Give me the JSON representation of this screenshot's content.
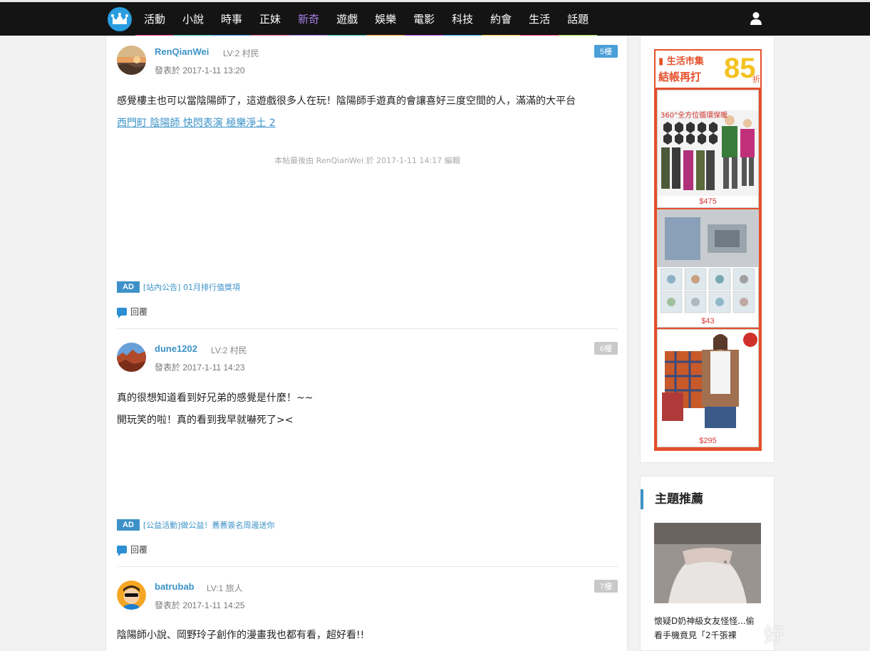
{
  "nav": {
    "items": [
      {
        "label": "活動",
        "color": "#e83e8c"
      },
      {
        "label": "小說",
        "color": "#2ab7a9"
      },
      {
        "label": "時事",
        "color": "#3b8ed9"
      },
      {
        "label": "正妹",
        "color": "#e85d9a"
      },
      {
        "label": "新奇",
        "color": "#a77ee8"
      },
      {
        "label": "遊戲",
        "color": "#2ab7a9"
      },
      {
        "label": "娛樂",
        "color": "#f0a030"
      },
      {
        "label": "電影",
        "color": "#b04ad8"
      },
      {
        "label": "科技",
        "color": "#22a3d8"
      },
      {
        "label": "約會",
        "color": "#f0c040"
      },
      {
        "label": "生活",
        "color": "#e83e6c"
      },
      {
        "label": "話題",
        "color": "#9bd84a"
      }
    ],
    "active_index": 4
  },
  "posts": [
    {
      "username": "RenQianWei",
      "level": "LV:2 村民",
      "date": "發表於 2017-1-11 13:20",
      "floor": "5樓",
      "lines": [
        "感覺樓主也可以當陰陽師了，這遊戲很多人在玩！陰陽師手遊真的會讓喜好三度空間的人，滿滿的大平台"
      ],
      "link": "西門町 陰陽師 快閃表演 極樂淨土 2",
      "edited": "本帖最後由 RenQianWei 於 2017-1-11 14:17 編輯",
      "ad_badge": "AD",
      "ad_text": "[站內公告] 01月排行值獎項",
      "reply": "回覆"
    },
    {
      "username": "dune1202",
      "level": "LV:2 村民",
      "date": "發表於 2017-1-11 14:23",
      "floor": "6樓",
      "lines": [
        "真的很想知道看到好兄弟的感覺是什麼！~~",
        "開玩笑的啦！真的看到我早就嚇死了><"
      ],
      "ad_badge": "AD",
      "ad_text": "[公益活動]做公益！蕎蕎簽名周邊送你",
      "reply": "回覆"
    },
    {
      "username": "batrubab",
      "level": "LV:1 旅人",
      "date": "發表於 2017-1-11 14:25",
      "floor": "7樓",
      "lines": [
        "陰陽師小說、岡野玲子創作的漫畫我也都有看，超好看!!"
      ]
    }
  ],
  "sidebar": {
    "ad": {
      "brand": "生活市集",
      "headline": "結帳再打",
      "discount": "85",
      "discount_suffix": "折",
      "product1_caption": "360°全方位循環保暖",
      "prices": [
        "$475",
        "$43",
        "$295"
      ]
    },
    "recommend": {
      "title": "主題推薦",
      "article": "懷疑D奶神級女友怪怪...偷看手機竟見「2千張裸"
    }
  },
  "watermark": "好"
}
